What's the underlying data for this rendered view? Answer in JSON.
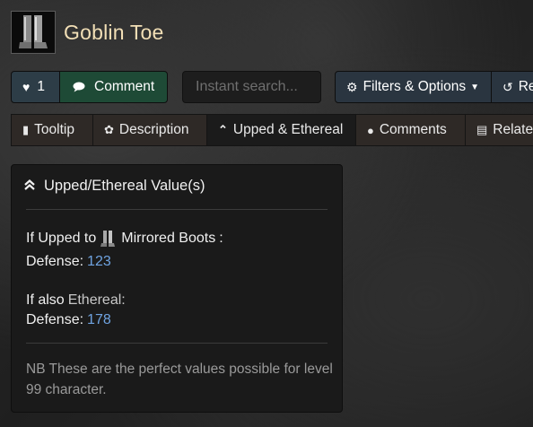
{
  "header": {
    "item_name": "Goblin Toe",
    "item_icon": "boots-icon"
  },
  "toolbar": {
    "like_icon": "heart-icon",
    "like_count": "1",
    "comment_icon": "comment-icon",
    "comment_label": "Comment",
    "search_placeholder": "Instant search...",
    "filters_icon": "gear-icon",
    "filters_label": "Filters & Options",
    "filters_caret": "caret-down-icon",
    "reset_icon": "undo-icon",
    "reset_label": "Re"
  },
  "tabs": [
    {
      "label": "Tooltip",
      "icon": "tooltip-icon"
    },
    {
      "label": "Description",
      "icon": "feather-icon"
    },
    {
      "label": "Upped & Ethereal",
      "icon": "double-chevron-up-icon",
      "active": true
    },
    {
      "label": "Comments",
      "icon": "comments-icon"
    },
    {
      "label": "Relate",
      "icon": "card-icon"
    }
  ],
  "panel": {
    "title": "Upped/Ethereal Value(s)",
    "upped_prefix": "If Upped to",
    "upped_item": "Mirrored Boots",
    "upped_suffix": ":",
    "defense_label_1": "Defense:",
    "defense_value_1": "123",
    "ethereal_prefix": "If also",
    "ethereal_word": "Ethereal:",
    "defense_label_2": "Defense:",
    "defense_value_2": "178",
    "note": "NB These are the perfect values possible for level 99 character."
  },
  "colors": {
    "title": "#f2dfb6",
    "value_blue": "#6fa3e0",
    "comment_green": "#1e4a36",
    "like_blue": "#2d3d47"
  }
}
